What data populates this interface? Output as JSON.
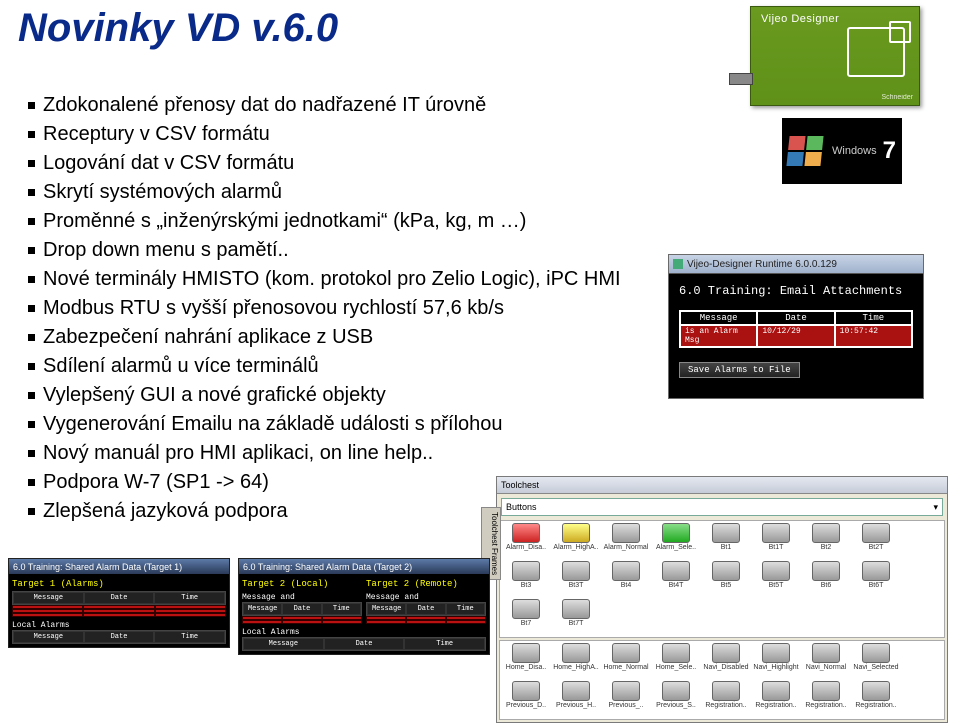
{
  "title": "Novinky VD v.6.0",
  "bullets": [
    "Zdokonalené přenosy dat do nadřazené IT úrovně",
    "Receptury v CSV formátu",
    "Logování dat v CSV formátu",
    "Skrytí systémových alarmů",
    "Proměnné s „inženýrskými jednotkami“ (kPa, kg, m …)",
    "Drop down menu s pamětí..",
    "Nové terminály HMISTO (kom. protokol pro Zelio Logic), iPC HMI",
    "Modbus RTU s vyšší přenosovou rychlostí 57,6 kb/s",
    "Zabezpečení nahrání aplikace z USB",
    "Sdílení alarmů u více terminálů",
    "Vylepšený GUI a nové grafické objekty",
    "Vygenerování Emailu na základě události s přílohou",
    "Nový manuál pro HMI aplikaci, on line help..",
    "Podpora W-7 (SP1 -> 64)",
    "Zlepšená jazyková podpora"
  ],
  "product_box": {
    "label": "Vijeo Designer",
    "brand": "Schneider"
  },
  "win7": {
    "brand": "Windows",
    "version": "7"
  },
  "runtime": {
    "title": "Vijeo-Designer Runtime 6.0.0.129",
    "heading": "6.0 Training: Email Attachments",
    "columns": [
      "Message",
      "Date",
      "Time"
    ],
    "row": [
      "is an Alarm Msg",
      "10/12/29",
      "10:57:42"
    ],
    "save_label": "Save Alarms to File"
  },
  "toolchest": {
    "title": "Toolchest",
    "sidetab": "Toolchest Frames",
    "dropdown": "Buttons",
    "row1": [
      "Alarm_Disa..",
      "Alarm_HighA..",
      "Alarm_Normal",
      "Alarm_Sele..",
      "Bt1",
      "Bt1T",
      "Bt2",
      "Bt2T",
      "Bt3"
    ],
    "row2": [
      "Bt3T",
      "Bt4",
      "Bt4T",
      "Bt5",
      "Bt5T",
      "Bt6",
      "Bt6T",
      "Bt7",
      "Bt7T"
    ],
    "row3": [
      "",
      "",
      "",
      "",
      "",
      "Home_Disa..",
      "Home_HighA..",
      "Home_Normal",
      "Home_Sele..",
      "Navi_Disabled"
    ],
    "row4": [
      "Navi_Highlight",
      "Navi_Normal",
      "Navi_Selected",
      "Previous_D..",
      "Previous_H..",
      "Previous_..",
      "Previous_S..",
      "Registration..",
      "Registration.."
    ],
    "row5": [
      "Registration..",
      "Registration.."
    ]
  },
  "alarm1": {
    "title": "6.0 Training: Shared Alarm Data (Target 1)",
    "label": "Target 1 (Alarms)",
    "cols": [
      "Message",
      "Date",
      "Time"
    ],
    "local": "Local Alarms"
  },
  "alarm2": {
    "title": "6.0 Training: Shared Alarm Data (Target 2)",
    "labelL": "Target 2 (Local)",
    "labelR": "Target 2 (Remote)",
    "subL": "Message and",
    "subR": "Message and",
    "cols": [
      "Message",
      "Date",
      "Time"
    ],
    "local": "Local Alarms"
  }
}
